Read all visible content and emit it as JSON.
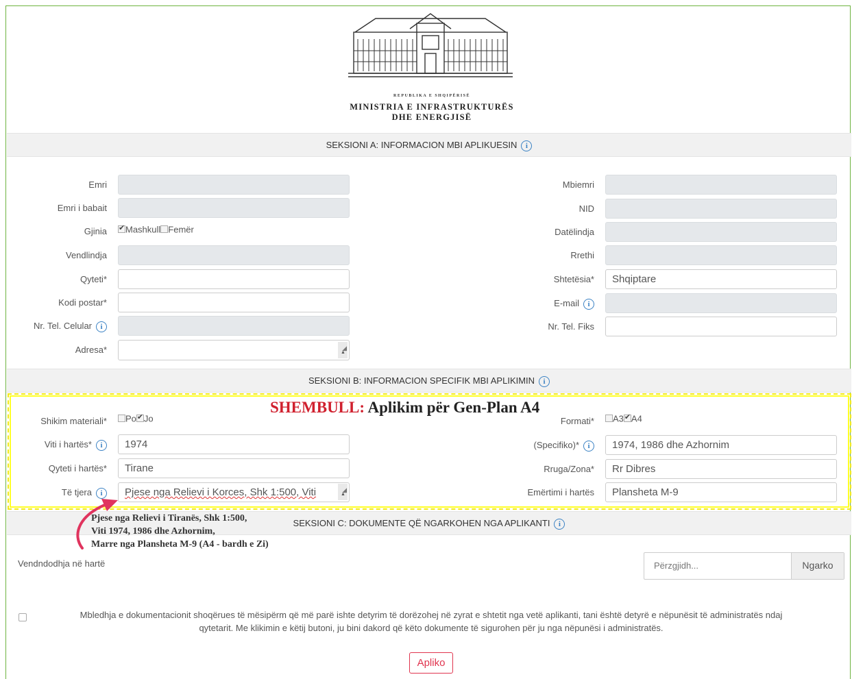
{
  "header": {
    "republika": "REPUBLIKA E SHQIPËRISË",
    "ministry_line1": "MINISTRIA E INFRASTRUKTURËS",
    "ministry_line2": "DHE ENERGJISË"
  },
  "section_a": {
    "title": "SEKSIONI A: INFORMACION MBI APLIKUESIN",
    "left": {
      "emri": "Emri",
      "emri_babait": "Emri i babait",
      "gjinia": "Gjinia",
      "mashkull": "Mashkull",
      "femer": "Femër",
      "vendlindja": "Vendlindja",
      "qyteti": "Qyteti*",
      "kodi_postar": "Kodi postar*",
      "nr_tel_celular": "Nr. Tel. Celular",
      "adresa": "Adresa*"
    },
    "right": {
      "mbiemri": "Mbiemri",
      "nid": "NID",
      "datelindja": "Datëlindja",
      "rrethi": "Rrethi",
      "shtetesia": "Shtetësia*",
      "shtetesia_value": "Shqiptare",
      "email": "E-mail",
      "nr_tel_fiks": "Nr. Tel. Fiks"
    }
  },
  "section_b": {
    "title": "SEKSIONI B: INFORMACION SPECIFIK MBI APLIKIMIN",
    "example_prefix": "SHEMBULL:",
    "example_text": " Aplikim për Gen-Plan A4",
    "shikim_materiali": "Shikim materiali*",
    "po": "Po",
    "jo": "Jo",
    "formati": "Formati*",
    "a3": "A3",
    "a4": "A4",
    "viti_hartes": "Viti i hartës*",
    "viti_value": "1974",
    "specifiko": "(Specifiko)*",
    "specifiko_value": "1974, 1986 dhe Azhornim",
    "qyteti_hartes": "Qyteti i hartës*",
    "qyteti_value": "Tirane",
    "rruga_zona": "Rruga/Zona*",
    "rruga_value": "Rr Dibres",
    "te_tjera": "Të tjera",
    "te_tjera_value": "Pjese nga Relievi i Korces, Shk 1:500, Viti",
    "emertimi_hartes": "Emërtimi i hartës",
    "emertimi_value": "Plansheta M-9"
  },
  "note": {
    "line1": "Pjese nga Relievi i Tiranës, Shk 1:500,",
    "line2": "Viti 1974, 1986 dhe Azhornim,",
    "line3": "Marre nga Plansheta M-9 (A4 - bardh e Zi)"
  },
  "section_c": {
    "title": "SEKSIONI C: DOKUMENTE QË NGARKOHEN NGA APLIKANTI",
    "vendndodhja": "Vendndodhja në hartë",
    "file_placeholder": "Përzgjidh...",
    "upload": "Ngarko"
  },
  "agreement": {
    "line1": "Mbledhja e dokumentacionit shoqërues të mësipërm që më parë ishte detyrim të dorëzohej në zyrat e shtetit nga vetë aplikanti, tani është detyrë e nëpunësit të administratës ndaj",
    "line2": "qytetarit. Me klikimin e këtij butoni, ju bini dakord që këto dokumente të sigurohen për ju nga nëpunësi i administratës."
  },
  "apply_button": "Apliko",
  "colors": {
    "accent_red": "#e0344e",
    "info_blue": "#3b82c4",
    "highlight_yellow": "#ffff00",
    "frame_green": "#6db33f"
  }
}
